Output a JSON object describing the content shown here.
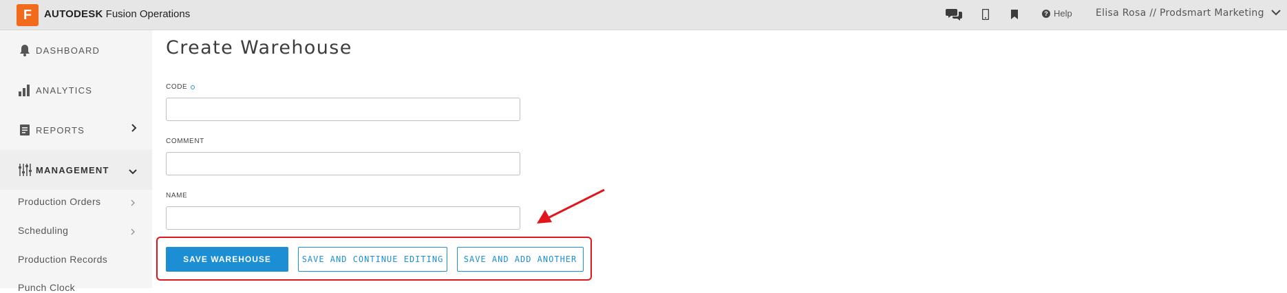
{
  "header": {
    "logo_letter": "F",
    "brand_bold": "AUTODESK",
    "brand_rest": " Fusion Operations",
    "help_label": "Help",
    "user_label": "Elisa Rosa // Prodsmart Marketing",
    "icons": [
      "chat-icon",
      "mobile-icon",
      "bookmark-icon",
      "help-icon",
      "chevron-down-icon"
    ]
  },
  "sidebar": {
    "items": [
      {
        "label": "DASHBOARD",
        "icon": "bell-icon"
      },
      {
        "label": "ANALYTICS",
        "icon": "bar-chart-icon"
      },
      {
        "label": "REPORTS",
        "icon": "document-icon"
      },
      {
        "label": "MANAGEMENT",
        "icon": "sliders-icon"
      }
    ],
    "sub_items": [
      {
        "label": "Production Orders"
      },
      {
        "label": "Scheduling"
      },
      {
        "label": "Production Records"
      },
      {
        "label": "Punch Clock"
      }
    ]
  },
  "main": {
    "title": "Create Warehouse",
    "fields": [
      {
        "label": "CODE",
        "value": "",
        "required": true
      },
      {
        "label": "COMMENT",
        "value": "",
        "required": false
      },
      {
        "label": "NAME",
        "value": "",
        "required": false
      }
    ],
    "buttons": {
      "save": "SAVE WAREHOUSE",
      "save_continue": "SAVE AND CONTINUE EDITING",
      "save_add": "SAVE AND ADD ANOTHER"
    }
  },
  "colors": {
    "accent": "#1b8ed4",
    "logo": "#f26b1d",
    "annotation": "#e1161c",
    "topbar": "#e6e6e6",
    "sidebar": "#f5f5f5"
  }
}
